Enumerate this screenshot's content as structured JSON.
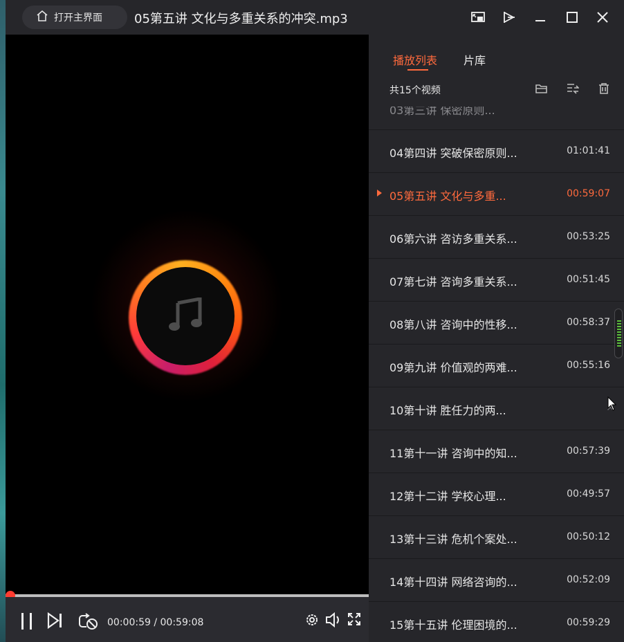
{
  "titlebar": {
    "home_label": "打开主界面",
    "title": "05第五讲  文化与多重关系的冲突.mp3"
  },
  "player": {
    "current_time": "00:00:59",
    "separator": " / ",
    "total_time": "00:59:08",
    "progress_fraction": 0.017
  },
  "panel": {
    "tabs": [
      {
        "label": "播放列表",
        "active": true
      },
      {
        "label": "片库",
        "active": false
      }
    ],
    "count_label": "共15个视频",
    "partial_item": "03第三讲 保密原则...",
    "items": [
      {
        "name": "04第四讲 突破保密原则...",
        "duration": "01:01:41"
      },
      {
        "name": "05第五讲  文化与多重...",
        "duration": "00:59:07",
        "playing": true
      },
      {
        "name": "06第六讲 咨访多重关系...",
        "duration": "00:53:25"
      },
      {
        "name": "07第七讲 咨询多重关系...",
        "duration": "00:51:45"
      },
      {
        "name": "08第八讲 咨询中的性移...",
        "duration": "00:58:37"
      },
      {
        "name": "09第九讲 价值观的两难...",
        "duration": "00:55:16"
      },
      {
        "name": "10第十讲  胜任力的两...",
        "duration": "",
        "hovered": true
      },
      {
        "name": "11第十一讲 咨询中的知...",
        "duration": "00:57:39"
      },
      {
        "name": "12第十二讲  学校心理...",
        "duration": "00:49:57"
      },
      {
        "name": "13第十三讲 危机个案处...",
        "duration": "00:50:12"
      },
      {
        "name": "14第十四讲 网络咨询的...",
        "duration": "00:52:09"
      },
      {
        "name": "15第十五讲 伦理困境的...",
        "duration": "00:59:29"
      }
    ]
  },
  "icons": {
    "remove": "✕"
  },
  "colors": {
    "accent": "#ff6a3d",
    "progress_knob": "#ff3b30",
    "scrollbar_green": "#5cbf3c"
  }
}
